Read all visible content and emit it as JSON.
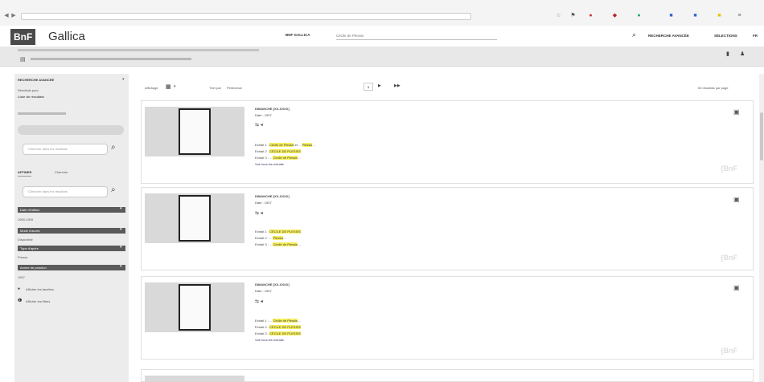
{
  "header": {
    "logo_abbr": "BnF",
    "logo_name": "Gallica",
    "search_scope": "BNF GALLICA",
    "search_query": "Cécile de Plessis",
    "nav": {
      "advanced": "RECHERCHE AVANCÉE",
      "selections": "SÉLECTIONS",
      "fr": "FR"
    }
  },
  "sidebar": {
    "section_title": "RECHERCHE AVANCÉE",
    "query_label": "Résultats pour",
    "results_count": "Liste de résultats",
    "tab_results": "AFFINER",
    "tab_search": "Chercher",
    "search_placeholder": "Chercher dans les résultats",
    "facets": [
      {
        "label": "Date d'édition",
        "value": "1900-1909"
      },
      {
        "label": "Mode d'accès",
        "value": "Disponible"
      },
      {
        "label": "Type d'après",
        "value": "Presse"
      },
      {
        "label": "Année de parution",
        "value": "1907"
      }
    ],
    "links": [
      "Afficher les facettes",
      "Afficher les filtres"
    ]
  },
  "toolbar": {
    "sort": "Pertinence",
    "page": "1",
    "per_page": "50 résultats par page"
  },
  "results": [
    {
      "title": "DIMANCHE [XX-XXXX]",
      "date": "Date : 1907",
      "extract_line1": "Extrait 1 : Cécile de Plessis et ... Plessis ...",
      "extract_line2": "Extrait 2 : CÉCILE DE PLESSIS",
      "extract_line3": "Extrait 3 : ... Cécile de Plessis ...",
      "link": "Voir tous les extraits"
    },
    {
      "title": "DIMANCHE [XX-XXXX]",
      "date": "Date : 1907",
      "extract_line1": "Extrait 1 : CÉCILE DE PLESSIS",
      "extract_line2": "Extrait 2 : ... Plessis ...",
      "extract_line3": "Extrait 3 : ... Cécile de Plessis ...",
      "link": "Voir tous les extraits"
    },
    {
      "title": "DIMANCHE [XX-XXXX]",
      "date": "Date : 1907",
      "extract_line1": "Extrait 1 : ... Cécile de Plessis ...",
      "extract_line2": "Extrait 2 : CÉCILE DE PLESSIS",
      "extract_line3": "Extrait 3 : CÉCILE DE PLESSIS",
      "link": "Voir tous les extraits"
    }
  ],
  "bnf_watermark": "{BnF"
}
